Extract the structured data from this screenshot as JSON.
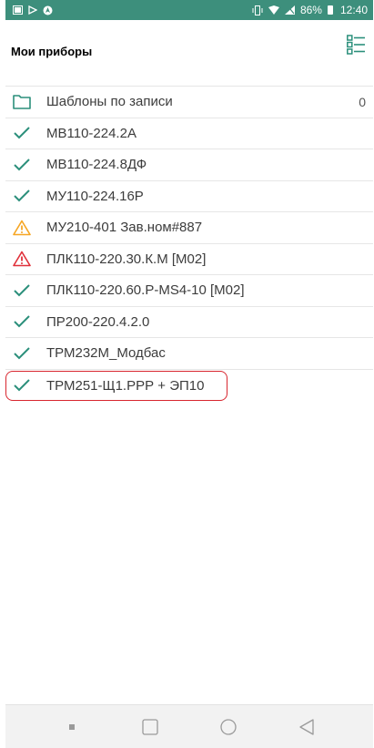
{
  "status_bar": {
    "battery_percent": "86%",
    "time": "12:40",
    "left_icons": [
      "message-icon",
      "play-icon",
      "navigation-icon"
    ],
    "right_icons": [
      "vibrate-icon",
      "wifi-icon",
      "signal-icon",
      "battery-icon"
    ]
  },
  "app_bar": {
    "title": "Мои приборы",
    "view_toggle_icon": "list-view-icon"
  },
  "colors": {
    "status_bar": "#3d8f7c",
    "accent_teal": "#2b8f7b",
    "warning_orange": "#f6a623",
    "error_red": "#e0303a",
    "selection_red": "#d8262f"
  },
  "items": [
    {
      "label": "Шаблоны по записи",
      "icon": "folder-icon",
      "count": "0"
    },
    {
      "label": "МВ110-224.2А",
      "icon": "check-icon"
    },
    {
      "label": "МВ110-224.8ДФ",
      "icon": "check-icon"
    },
    {
      "label": "МУ110-224.16Р",
      "icon": "check-icon"
    },
    {
      "label": "МУ210-401 Зав.ном#887",
      "icon": "warning-icon"
    },
    {
      "label": "ПЛК110-220.30.К.М [M02]",
      "icon": "error-icon"
    },
    {
      "label": "ПЛК110-220.60.Р-MS4-10 [M02]",
      "icon": "check-icon"
    },
    {
      "label": "ПР200-220.4.2.0",
      "icon": "check-icon"
    },
    {
      "label": "ТРМ232М_Модбас",
      "icon": "check-icon"
    },
    {
      "label": "ТРМ251-Щ1.РРР + ЭП10",
      "icon": "check-icon",
      "selected": true
    }
  ],
  "nav_bar": {
    "buttons": [
      "menu-dot-icon",
      "home-square-icon",
      "circle-icon",
      "back-triangle-icon"
    ]
  }
}
